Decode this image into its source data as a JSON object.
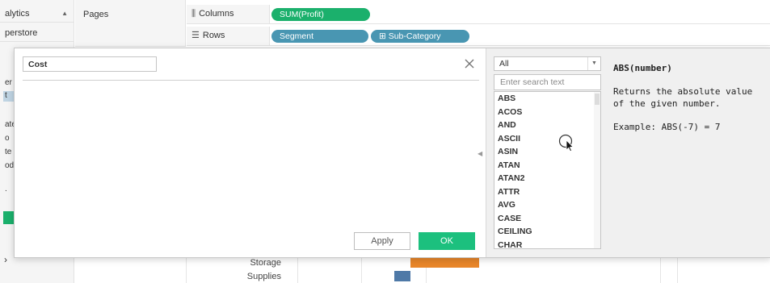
{
  "workbook": {
    "left_panel": {
      "datasource_title": "alytics",
      "datasource_name": "perstore",
      "partial_fields": [
        "er",
        "t",
        "ate",
        "o",
        "te",
        "ode",
        "."
      ],
      "bottom_glyph": "›"
    },
    "pages_label": "Pages",
    "columns": {
      "label": "Columns",
      "icon": "columns-icon",
      "pills": [
        "SUM(Profit)"
      ]
    },
    "rows": {
      "label": "Rows",
      "icon": "rows-icon",
      "pills": [
        "Segment",
        "⊞ Sub-Category"
      ]
    },
    "view_rows": [
      {
        "label": "Storage",
        "color": "#e8862a"
      },
      {
        "label": "Supplies",
        "color": "#4e79a7"
      }
    ],
    "colors": {
      "profit_pill": "#1bb06c",
      "dimension_pill": "#4996b2"
    }
  },
  "dialog": {
    "calc_name": "Cost",
    "formula": "",
    "close_icon": "close-icon",
    "apply_label": "Apply",
    "ok_label": "OK",
    "ok_color": "#1cc07e",
    "function_panel": {
      "category": "All",
      "search_placeholder": "Enter search text",
      "functions": [
        "ABS",
        "ACOS",
        "AND",
        "ASCII",
        "ASIN",
        "ATAN",
        "ATAN2",
        "ATTR",
        "AVG",
        "CASE",
        "CEILING",
        "CHAR"
      ],
      "selected": {
        "signature": "ABS(number)",
        "description": "Returns the absolute value of the given number.",
        "example": "Example: ABS(-7) = 7"
      }
    }
  }
}
